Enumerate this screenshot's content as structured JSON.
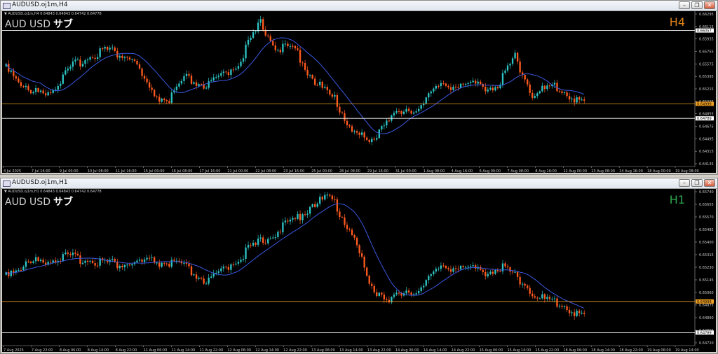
{
  "window_top": {
    "title": "AUDUSD.oj1m,H4",
    "header": "▼ AUDUSD.oj1m,H4 0.64843 0.64843 0.64742 0.64778",
    "symbol_label": "AUD USD",
    "tag_label": "サブ",
    "timeframe_label": "H4",
    "price_ticks": [
      "0.66295",
      "0.66115",
      "0.65935",
      "0.65755",
      "0.65575",
      "0.65395",
      "0.65215",
      "0.65035",
      "0.64855",
      "0.64675",
      "0.64495",
      "0.64315",
      "0.64135"
    ],
    "time_ticks": [
      "4 Jul 2025",
      "7 Jul 16:00",
      "9 Jul 00:00",
      "10 Jul 08:00",
      "11 Jul 16:00",
      "15 Jul 00:00",
      "16 Jul 08:00",
      "17 Jul 16:00",
      "21 Jul 00:00",
      "22 Jul 08:00",
      "23 Jul 16:00",
      "25 Jul 00:00",
      "28 Jul 08:00",
      "29 Jul 16:00",
      "31 Jul 00:00",
      "1 Aug 08:00",
      "4 Aug 16:00",
      "6 Aug 00:00",
      "7 Aug 08:00",
      "8 Aug 16:00",
      "12 Aug 00:00",
      "13 Aug 08:00",
      "14 Aug 16:00",
      "18 Aug 00:00",
      "19 Aug 08:00"
    ],
    "line_labels": [
      {
        "value": "0.66057",
        "color": "#ffffff"
      },
      {
        "value": "0.64999",
        "color": "#f0a020"
      },
      {
        "value": "0.64789",
        "color": "#ffffff"
      }
    ],
    "colors": {
      "up": "#2ec4c4",
      "down": "#ff5a1f",
      "ma": "#3a58e0",
      "level_white": "#ffffff",
      "level_orange": "#f0a020"
    },
    "chart_data": {
      "type": "candlestick",
      "ylim": [
        0.64135,
        0.66295
      ],
      "ma_period_note": "",
      "levels": [
        0.66057,
        0.64999,
        0.64789
      ]
    }
  },
  "window_bottom": {
    "title": "AUDUSD.oj1m,H1",
    "header": "▼ AUDUSD.oj1m,H1 0.64843 0.64843 0.64742 0.64778",
    "symbol_label": "AUD USD",
    "tag_label": "サブ",
    "timeframe_label": "H1",
    "price_ticks": [
      "0.65740",
      "0.65655",
      "0.65570",
      "0.65485",
      "0.65400",
      "0.65315",
      "0.65230",
      "0.65145",
      "0.65060",
      "0.64975",
      "0.64890",
      "0.64805",
      "0.64720"
    ],
    "time_ticks": [
      "7 Aug 2025",
      "7 Aug 22:00",
      "8 Aug 06:00",
      "8 Aug 14:00",
      "8 Aug 22:00",
      "11 Aug 06:00",
      "11 Aug 14:00",
      "11 Aug 22:00",
      "12 Aug 06:00",
      "12 Aug 14:00",
      "12 Aug 22:00",
      "13 Aug 06:00",
      "13 Aug 14:00",
      "13 Aug 22:00",
      "14 Aug 06:00",
      "14 Aug 14:00",
      "14 Aug 22:00",
      "15 Aug 06:00",
      "15 Aug 14:00",
      "15 Aug 22:00",
      "18 Aug 06:00",
      "18 Aug 14:00",
      "18 Aug 22:00",
      "19 Aug 06:00",
      "19 Aug 14:00"
    ],
    "line_labels": [
      {
        "value": "0.64999",
        "color": "#f0a020"
      },
      {
        "value": "0.64789",
        "color": "#ffffff"
      }
    ],
    "colors": {
      "up": "#2ec4c4",
      "down": "#ff5a1f",
      "ma": "#3a58e0",
      "level_white": "#ffffff",
      "level_orange": "#f0a020"
    },
    "chart_data": {
      "type": "candlestick",
      "ylim": [
        0.6472,
        0.6574
      ],
      "levels": [
        0.64999,
        0.64789
      ]
    }
  }
}
